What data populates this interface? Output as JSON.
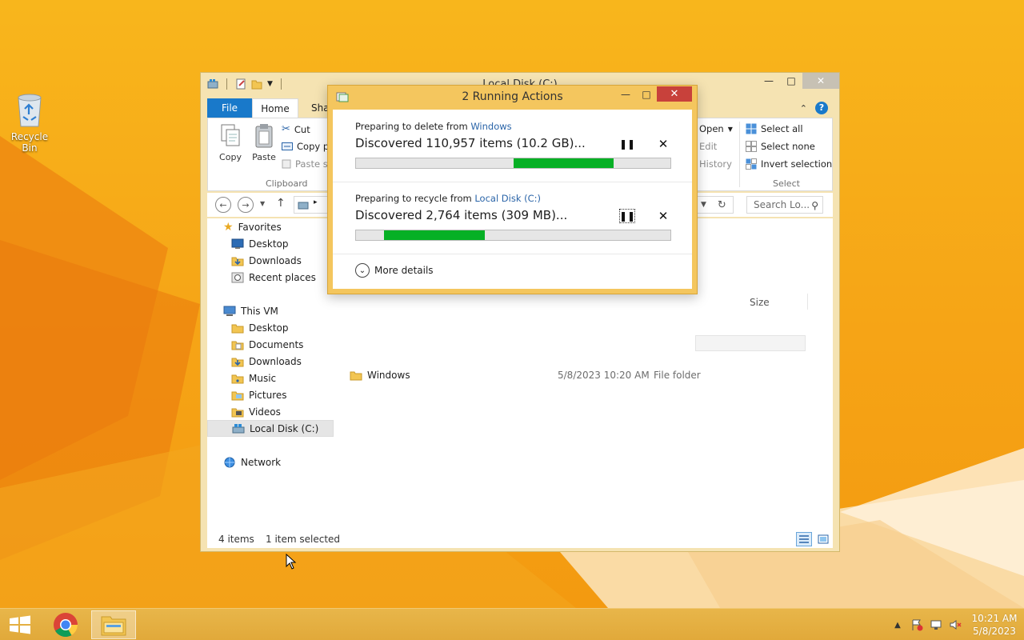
{
  "desktop": {
    "recycle_bin_label": "Recycle Bin"
  },
  "explorer": {
    "title": "Local Disk (C:)",
    "tabs": {
      "file": "File",
      "home": "Home",
      "share": "Shar"
    },
    "ribbon": {
      "copy": "Copy",
      "paste": "Paste",
      "cut": "Cut",
      "copy_path": "Copy pa",
      "paste_shortcut": "Paste sh",
      "clipboard_group": "Clipboard",
      "open": "Open",
      "edit": "Edit",
      "history": "History",
      "select_all": "Select all",
      "select_none": "Select none",
      "invert_selection": "Invert selection",
      "select_group": "Select"
    },
    "search_placeholder": "Search Lo...",
    "column_size": "Size",
    "nav": {
      "favorites": "Favorites",
      "fav_items": [
        "Desktop",
        "Downloads",
        "Recent places"
      ],
      "this_pc": "This VM",
      "pc_items": [
        "Desktop",
        "Documents",
        "Downloads",
        "Music",
        "Pictures",
        "Videos",
        "Local Disk (C:)"
      ],
      "network": "Network"
    },
    "file_row": {
      "name": "Windows",
      "date": "5/8/2023 10:20 AM",
      "type": "File folder"
    },
    "status": {
      "items": "4 items",
      "selected": "1 item selected"
    }
  },
  "dialog": {
    "title": "2 Running Actions",
    "operations": [
      {
        "prefix": "Preparing to delete from ",
        "source": "Windows",
        "detail": "Discovered 110,957 items (10.2 GB)...",
        "progress_start": 0.5,
        "progress_end": 0.82
      },
      {
        "prefix": "Preparing to recycle from ",
        "source": "Local Disk (C:)",
        "detail": "Discovered 2,764 items (309 MB)...",
        "progress_start": 0.09,
        "progress_end": 0.41
      }
    ],
    "more_details": "More details"
  },
  "taskbar": {
    "time": "10:21 AM",
    "date": "5/8/2023"
  },
  "colors": {
    "accent_blue": "#1979ca",
    "progress_green": "#06b025",
    "dialog_frame": "#f4c65e",
    "close_red": "#c8413b"
  }
}
